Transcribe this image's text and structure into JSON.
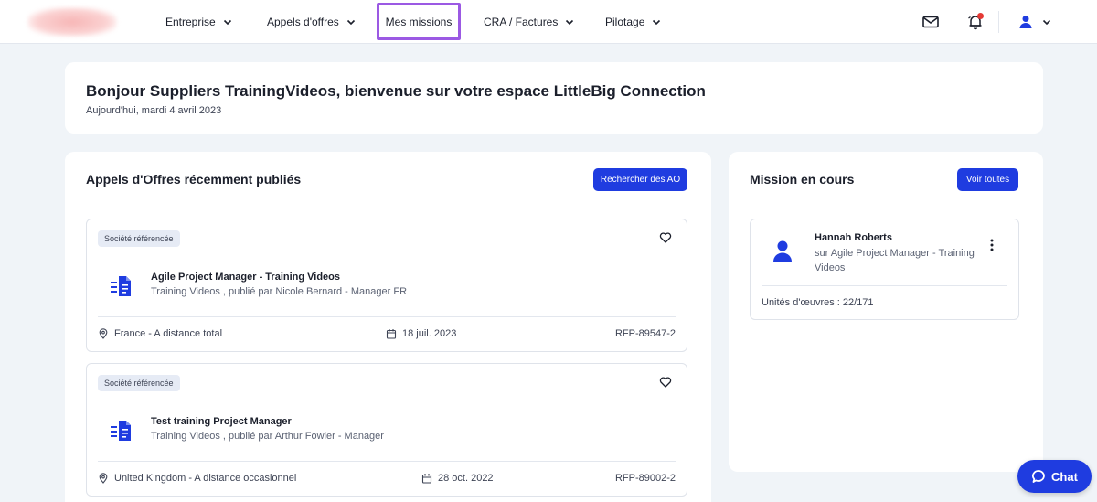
{
  "nav": {
    "items": [
      {
        "label": "Entreprise"
      },
      {
        "label": "Appels d'offres"
      },
      {
        "label": "Mes missions"
      },
      {
        "label": "CRA / Factures"
      },
      {
        "label": "Pilotage"
      }
    ],
    "icons": [
      "mail-icon",
      "bell-icon",
      "user-icon",
      "chevron-down-icon"
    ]
  },
  "welcome": {
    "title": "Bonjour Suppliers TrainingVideos, bienvenue sur votre espace LittleBig Connection",
    "date": "Aujourd'hui, mardi 4 avril 2023"
  },
  "ao_section": {
    "title": "Appels d'Offres récemment publiés",
    "search_button": "Rechercher des AO",
    "offers": [
      {
        "tag": "Société référencée",
        "title": "Agile Project Manager - Training Videos",
        "subtitle": "Training Videos , publié par Nicole Bernard - Manager FR",
        "location": "France - A distance total",
        "date": "18 juil. 2023",
        "ref": "RFP-89547-2"
      },
      {
        "tag": "Société référencée",
        "title": "Test training Project Manager",
        "subtitle": "Training Videos , publié par Arthur Fowler - Manager",
        "location": "United Kingdom - A distance occasionnel",
        "date": "28 oct. 2022",
        "ref": "RFP-89002-2"
      }
    ]
  },
  "mission_section": {
    "title": "Mission en cours",
    "view_all_button": "Voir toutes",
    "mission": {
      "name": "Hannah Roberts",
      "description": "sur Agile Project Manager - Training Videos",
      "units": "Unités d'œuvres : 22/171"
    }
  },
  "chat": {
    "label": "Chat"
  },
  "colors": {
    "primary": "#1f3ce0",
    "active_outline": "#9b59e3",
    "notification": "#e53935"
  }
}
